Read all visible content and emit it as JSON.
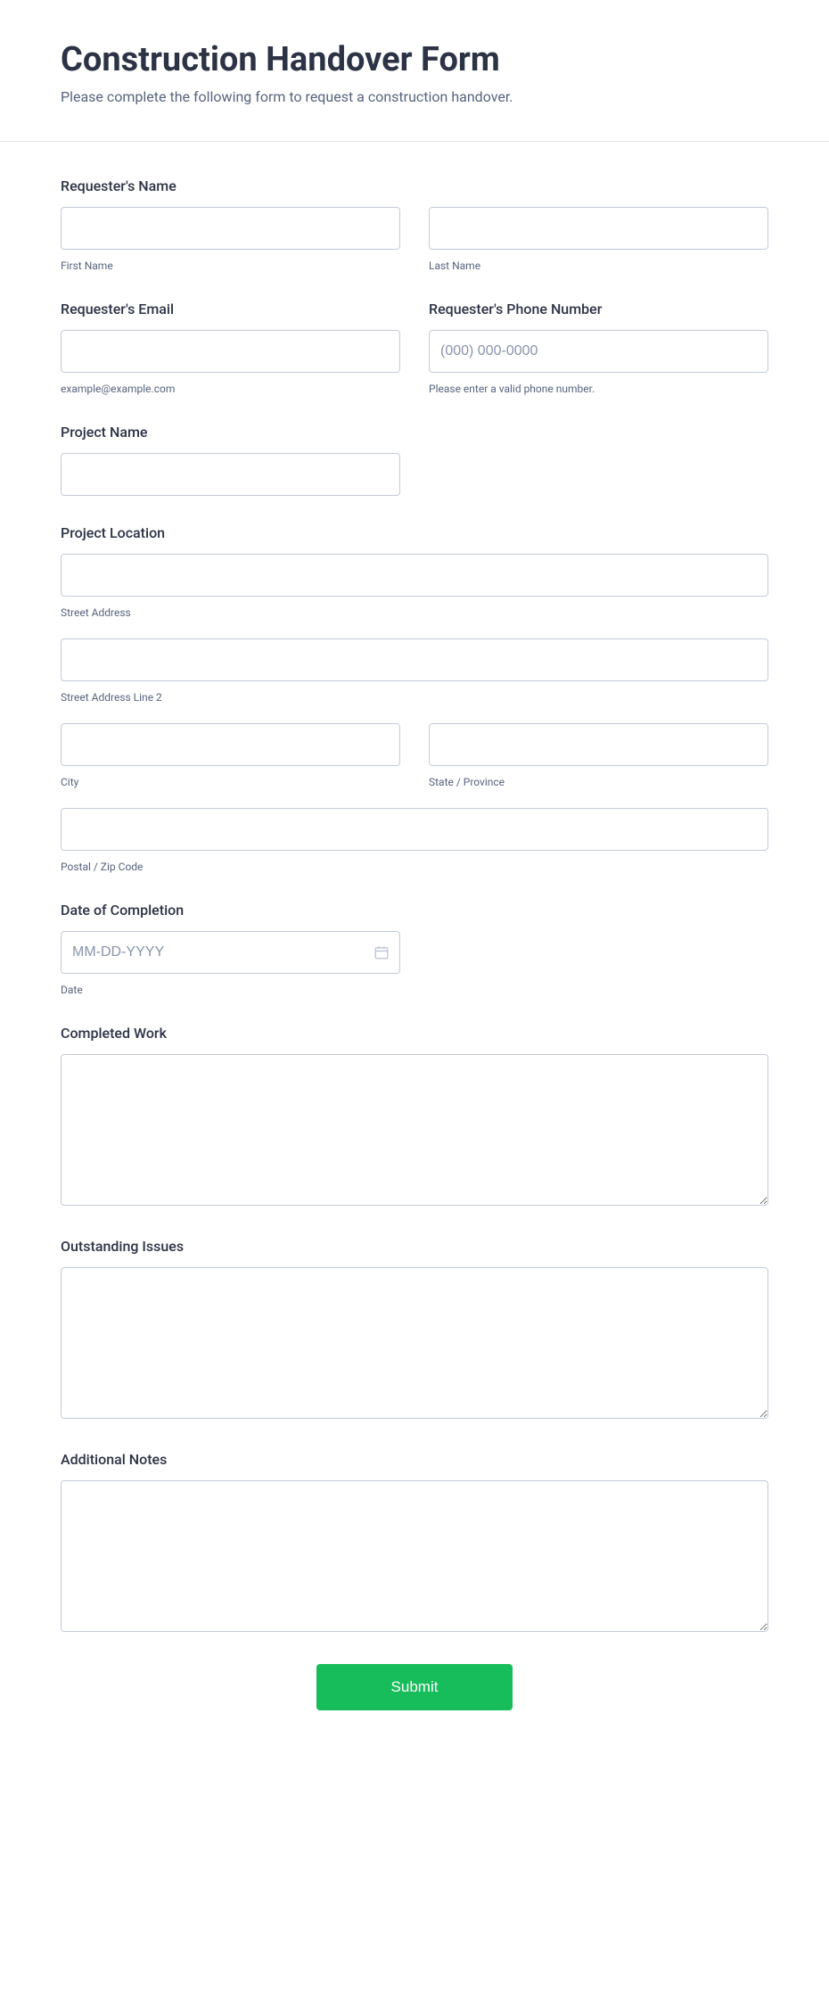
{
  "header": {
    "title": "Construction Handover Form",
    "subtitle": "Please complete the following form to request a construction handover."
  },
  "fields": {
    "requester_name": {
      "label": "Requester's Name",
      "first_sublabel": "First Name",
      "last_sublabel": "Last Name"
    },
    "requester_email": {
      "label": "Requester's Email",
      "sublabel": "example@example.com"
    },
    "requester_phone": {
      "label": "Requester's Phone Number",
      "placeholder": "(000) 000-0000",
      "sublabel": "Please enter a valid phone number."
    },
    "project_name": {
      "label": "Project Name"
    },
    "project_location": {
      "label": "Project Location",
      "street_sublabel": "Street Address",
      "street2_sublabel": "Street Address Line 2",
      "city_sublabel": "City",
      "state_sublabel": "State / Province",
      "postal_sublabel": "Postal / Zip Code"
    },
    "date_completion": {
      "label": "Date of Completion",
      "placeholder": "MM-DD-YYYY",
      "sublabel": "Date"
    },
    "completed_work": {
      "label": "Completed Work"
    },
    "outstanding_issues": {
      "label": "Outstanding Issues"
    },
    "additional_notes": {
      "label": "Additional Notes"
    }
  },
  "submit": {
    "label": "Submit"
  }
}
